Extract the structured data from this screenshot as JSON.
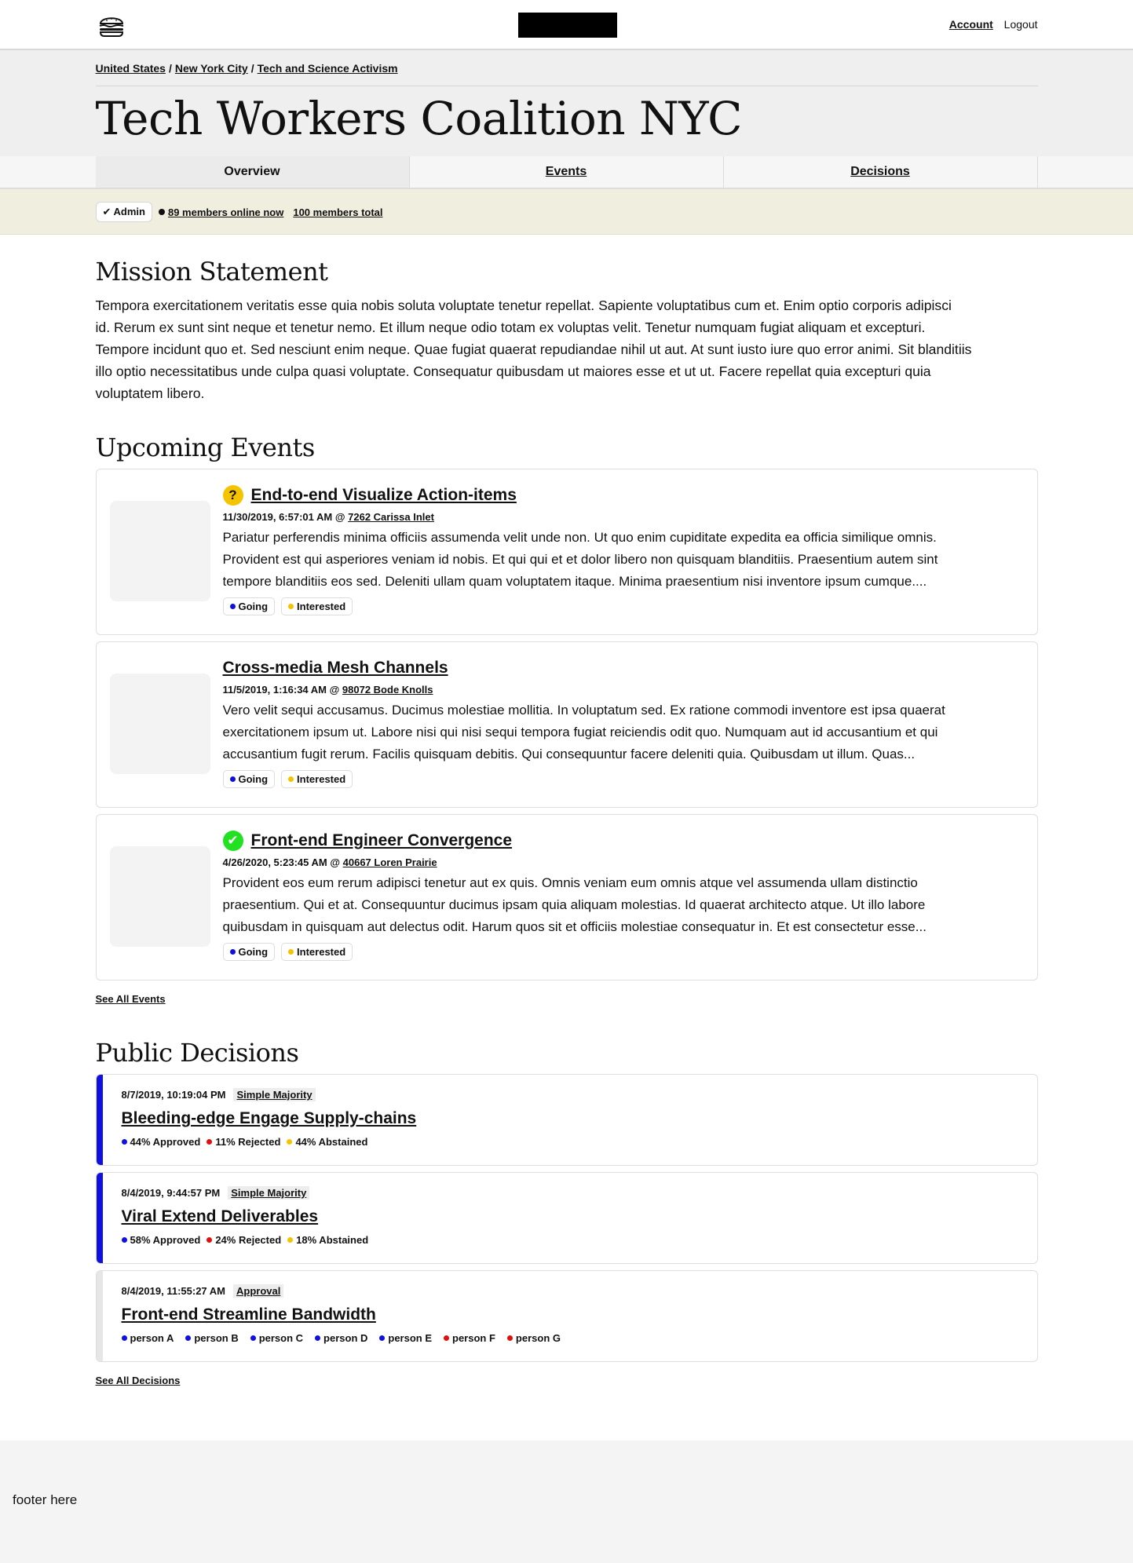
{
  "nav": {
    "account_label": "Account",
    "logout_label": "Logout"
  },
  "breadcrumb": [
    {
      "label": "United States"
    },
    {
      "label": "New York City"
    },
    {
      "label": "Tech and Science Activism"
    }
  ],
  "group": {
    "title": "Tech Workers Coalition NYC"
  },
  "tabs": [
    {
      "label": "Overview",
      "active": true
    },
    {
      "label": "Events",
      "active": false
    },
    {
      "label": "Decisions",
      "active": false
    }
  ],
  "status": {
    "admin_label": "✔ Admin",
    "online_label": "89 members online now",
    "total_label": "100 members total",
    "online_dot_color": "#111111"
  },
  "mission": {
    "heading": "Mission Statement",
    "lines": [
      "Tempora exercitationem veritatis esse quia nobis soluta voluptate tenetur repellat. Sapiente voluptatibus cum et. Enim optio corporis adipisci",
      "id. Rerum ex sunt sint neque et tenetur nemo. Et illum neque odio totam ex voluptas velit. Tenetur numquam fugiat aliquam et excepturi.",
      "Tempore incidunt quo et. Sed nesciunt enim neque. Quae fugiat quaerat repudiandae nihil ut aut. At sunt iusto iure quo error animi. Sit blanditiis",
      "illo optio necessitatibus unde culpa quasi voluptate. Consequatur quibusdam ut maiores esse et ut ut. Facere repellat quia excepturi quia",
      "voluptatem libero."
    ]
  },
  "events": {
    "heading": "Upcoming Events",
    "going_label": "Going",
    "interested_label": "Interested",
    "going_color": "#1010e0",
    "interested_color": "#f5c400",
    "see_all_label": "See All Events",
    "items": [
      {
        "status_icon": "question-icon",
        "status_glyph": "?",
        "title": "End-to-end Visualize Action-items",
        "datetime": "11/30/2019, 6:57:01 AM @ ",
        "location": "7262 Carissa Inlet",
        "desc_lines": [
          "Pariatur perferendis minima officiis assumenda velit unde non. Ut quo enim cupiditate expedita ea officia similique omnis.",
          "Provident est qui asperiores veniam id nobis. Et qui qui et et dolor libero non quisquam blanditiis. Praesentium autem sint",
          "tempore blanditiis eos sed. Deleniti ullam quam voluptatem itaque. Minima praesentium nisi inventore ipsum cumque...."
        ]
      },
      {
        "status_icon": "",
        "status_glyph": "",
        "title": "Cross-media Mesh Channels",
        "datetime": "11/5/2019, 1:16:34 AM @ ",
        "location": "98072 Bode Knolls",
        "desc_lines": [
          "Vero velit sequi accusamus. Ducimus molestiae mollitia. In voluptatum sed. Ex ratione commodi inventore est ipsa quaerat",
          "exercitationem ipsum ut. Labore nisi qui nisi sequi tempora fugiat reiciendis odit quo. Numquam aut id accusantium et qui",
          "accusantium fugit rerum. Facilis quisquam debitis. Qui consequuntur facere deleniti quia. Quibusdam ut illum. Quas..."
        ]
      },
      {
        "status_icon": "checkmark-icon",
        "status_glyph": "✔",
        "title": "Front-end Engineer Convergence",
        "datetime": "4/26/2020, 5:23:45 AM @ ",
        "location": "40667 Loren Prairie",
        "desc_lines": [
          "Provident eos eum rerum adipisci tenetur aut ex quis. Omnis veniam eum omnis atque vel assumenda ullam distinctio",
          "praesentium. Qui et at. Consequuntur ducimus ipsam quia aliquam molestias. Id quaerat architecto atque. Ut illo labore",
          "quibusdam in quisquam aut delectus odit. Harum quos sit et officiis molestiae consequatur in. Et est consectetur esse..."
        ]
      }
    ]
  },
  "decisions": {
    "heading": "Public Decisions",
    "see_all_label": "See All Decisions",
    "items": [
      {
        "datetime": "8/7/2019, 10:19:04 PM",
        "vote_type": "Simple Majority",
        "title": "Bleeding-edge Engage Supply-chains",
        "bar_color": "#1010e0",
        "stats": [
          {
            "label": "44% Approved",
            "color": "#1010e0"
          },
          {
            "label": "11% Rejected",
            "color": "#e01010"
          },
          {
            "label": "44% Abstained",
            "color": "#f5c400"
          }
        ]
      },
      {
        "datetime": "8/4/2019, 9:44:57 PM",
        "vote_type": "Simple Majority",
        "title": "Viral Extend Deliverables",
        "bar_color": "#1010e0",
        "stats": [
          {
            "label": "58% Approved",
            "color": "#1010e0"
          },
          {
            "label": "24% Rejected",
            "color": "#e01010"
          },
          {
            "label": "18% Abstained",
            "color": "#f5c400"
          }
        ]
      },
      {
        "datetime": "8/4/2019, 11:55:27 AM",
        "vote_type": "Approval",
        "title": "Front-end Streamline Bandwidth",
        "bar_color": "#e6e6e6",
        "people": [
          {
            "label": "person A",
            "color": "#1010e0"
          },
          {
            "label": "person B",
            "color": "#1010e0"
          },
          {
            "label": "person C",
            "color": "#1010e0"
          },
          {
            "label": "person D",
            "color": "#1010e0"
          },
          {
            "label": "person E",
            "color": "#1010e0"
          },
          {
            "label": "person F",
            "color": "#e01010"
          },
          {
            "label": "person G",
            "color": "#e01010"
          }
        ]
      }
    ]
  },
  "footer": {
    "text": "footer here"
  }
}
